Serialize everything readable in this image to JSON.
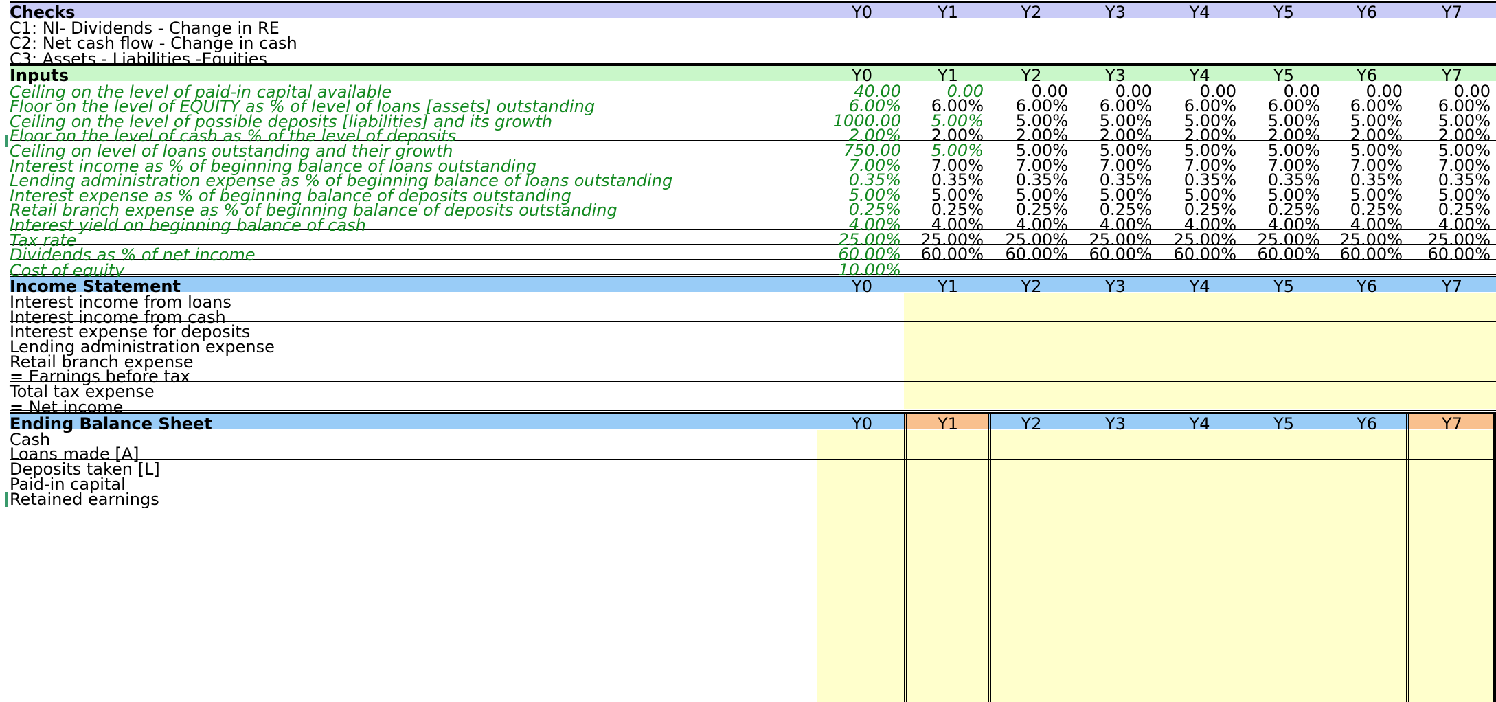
{
  "colors": {
    "checks_header": "#c9cbf7",
    "inputs_header": "#c9f7c9",
    "section_header": "#99ccf7",
    "input_text": "#12891f",
    "calc_fill": "#ffffcc",
    "highlight_year": "#f9c08e"
  },
  "years": [
    "Y0",
    "Y1",
    "Y2",
    "Y3",
    "Y4",
    "Y5",
    "Y6",
    "Y7"
  ],
  "checks": {
    "title": "Checks",
    "rows": [
      "C1: NI- Dividends - Change in RE",
      "C2: Net cash flow - Change in cash",
      "C3: Assets - Liabilities -Equities"
    ]
  },
  "inputs": {
    "title": "Inputs",
    "rows": [
      {
        "label": "Ceiling on the level of paid-in capital available",
        "y0": "40.00",
        "vals": [
          "0.00",
          "0.00",
          "0.00",
          "0.00",
          "0.00",
          "0.00",
          "0.00"
        ],
        "y1_input": true
      },
      {
        "label": "Floor on the level of EQUITY as % of level of loans [assets] outstanding",
        "y0": "6.00%",
        "vals": [
          "6.00%",
          "6.00%",
          "6.00%",
          "6.00%",
          "6.00%",
          "6.00%",
          "6.00%"
        ],
        "y1_input": false
      },
      {
        "label": "Ceiling on the level of possible deposits [liabilities] and its growth",
        "y0": "1000.00",
        "vals": [
          "5.00%",
          "5.00%",
          "5.00%",
          "5.00%",
          "5.00%",
          "5.00%",
          "5.00%"
        ],
        "y1_input": true
      },
      {
        "label": "Floor on the level of cash as % of the level of deposits",
        "y0": "2.00%",
        "vals": [
          "2.00%",
          "2.00%",
          "2.00%",
          "2.00%",
          "2.00%",
          "2.00%",
          "2.00%"
        ],
        "y1_input": false
      },
      {
        "label": "Ceiling on level of loans outstanding and their growth",
        "y0": "750.00",
        "vals": [
          "5.00%",
          "5.00%",
          "5.00%",
          "5.00%",
          "5.00%",
          "5.00%",
          "5.00%"
        ],
        "y1_input": true
      },
      {
        "label": "Interest income as % of beginning balance of loans outstanding",
        "y0": "7.00%",
        "vals": [
          "7.00%",
          "7.00%",
          "7.00%",
          "7.00%",
          "7.00%",
          "7.00%",
          "7.00%"
        ],
        "y1_input": false
      },
      {
        "label": "Lending administration expense as % of beginning balance of loans outstanding",
        "y0": "0.35%",
        "vals": [
          "0.35%",
          "0.35%",
          "0.35%",
          "0.35%",
          "0.35%",
          "0.35%",
          "0.35%"
        ],
        "y1_input": false
      },
      {
        "label": "Interest expense  as % of beginning balance of deposits outstanding",
        "y0": "5.00%",
        "vals": [
          "5.00%",
          "5.00%",
          "5.00%",
          "5.00%",
          "5.00%",
          "5.00%",
          "5.00%"
        ],
        "y1_input": false
      },
      {
        "label": "Retail branch expense as % of beginning balance of deposits outstanding",
        "y0": "0.25%",
        "vals": [
          "0.25%",
          "0.25%",
          "0.25%",
          "0.25%",
          "0.25%",
          "0.25%",
          "0.25%"
        ],
        "y1_input": false
      },
      {
        "label": "Interest yield on beginning balance of cash",
        "y0": "4.00%",
        "vals": [
          "4.00%",
          "4.00%",
          "4.00%",
          "4.00%",
          "4.00%",
          "4.00%",
          "4.00%"
        ],
        "y1_input": false
      },
      {
        "label": "Tax rate",
        "y0": "25.00%",
        "vals": [
          "25.00%",
          "25.00%",
          "25.00%",
          "25.00%",
          "25.00%",
          "25.00%",
          "25.00%"
        ],
        "y1_input": false
      },
      {
        "label": "Dividends as % of net income",
        "y0": "60.00%",
        "vals": [
          "60.00%",
          "60.00%",
          "60.00%",
          "60.00%",
          "60.00%",
          "60.00%",
          "60.00%"
        ],
        "y1_input": false
      },
      {
        "label": "Cost of equity",
        "y0": "10.00%",
        "vals": [],
        "y1_input": false
      }
    ]
  },
  "income_statement": {
    "title": "Income Statement",
    "rows": [
      "Interest income from loans",
      "Interest income from cash",
      "Interest expense for deposits",
      "Lending administration expense",
      "Retail branch expense",
      "= Earnings before tax",
      "Total tax expense",
      "= Net income"
    ]
  },
  "balance_sheet": {
    "title": "Ending Balance Sheet",
    "rows": [
      "Cash",
      "Loans made [A]",
      "Deposits taken [L]",
      "Paid-in capital",
      "Retained earnings"
    ]
  }
}
